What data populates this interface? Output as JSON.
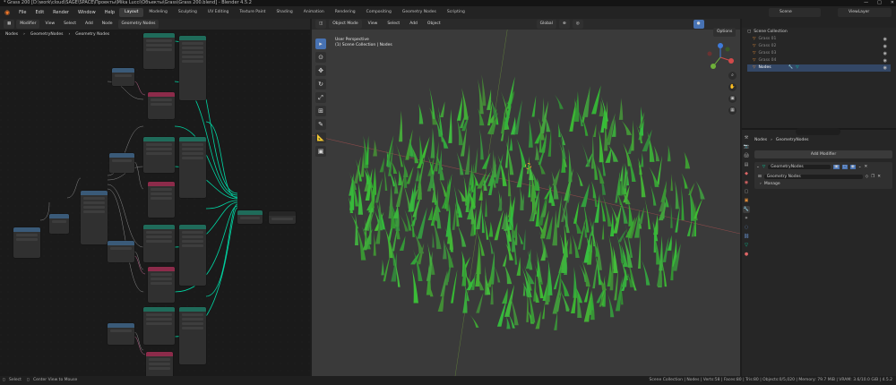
{
  "window": {
    "title": "* Grass 200 [D:\\work\\cloud\\SAGE\\SPACE\\Проекты\\Mika Lucci\\Объекты\\Grass\\Grass 200.blend] - Blender 4.5.2",
    "controls": [
      "—",
      "□",
      "✕"
    ]
  },
  "menus": [
    "File",
    "Edit",
    "Render",
    "Window",
    "Help"
  ],
  "workspaces": [
    {
      "label": "Layout",
      "active": true
    },
    {
      "label": "Modeling"
    },
    {
      "label": "Sculpting"
    },
    {
      "label": "UV Editing"
    },
    {
      "label": "Texture Paint"
    },
    {
      "label": "Shading"
    },
    {
      "label": "Animation"
    },
    {
      "label": "Rendering"
    },
    {
      "label": "Compositing"
    },
    {
      "label": "Geometry Nodes"
    },
    {
      "label": "Scripting"
    }
  ],
  "scene": "Scene",
  "view_layer": "ViewLayer",
  "node_editor": {
    "header": {
      "editor": "Modifier",
      "menus": [
        "View",
        "Select",
        "Add",
        "Node"
      ],
      "tree": "Geometry Nodes"
    },
    "breadcrumb": [
      "Nodes",
      "GeometryNodes",
      "Geometry Nodes"
    ]
  },
  "viewport": {
    "header": {
      "mode": "Object Mode",
      "menus": [
        "View",
        "Select",
        "Add",
        "Object"
      ],
      "orientation": "Global",
      "options": "Options"
    },
    "info_line1": "User Perspective",
    "info_line2": "(1) Scene Collection | Nodes",
    "tools": [
      "select-box",
      "cursor",
      "move",
      "rotate",
      "scale",
      "transform",
      "annotate",
      "measure",
      "add-cube"
    ]
  },
  "outliner": {
    "root": "Scene Collection",
    "items": [
      {
        "label": "Grass 01"
      },
      {
        "label": "Grass 02"
      },
      {
        "label": "Grass 03"
      },
      {
        "label": "Grass 04"
      },
      {
        "label": "Nodes"
      }
    ]
  },
  "properties": {
    "search_placeholder": "",
    "breadcrumb": [
      "Nodes",
      "GeometryNodes"
    ],
    "add_modifier": "Add Modifier",
    "modifier_name": "GeometryNodes",
    "node_group": "Geometry Nodes",
    "manage": "Manage"
  },
  "status": {
    "left_select": "Select",
    "left_center": "Center View to Mouse",
    "right": "Scene Collection | Nodes | Verts:58 | Faces:80 | Tris:80 | Objects:0/5,020 | Memory: 79.7 MiB | VRAM: 3.6/10.0 GiB | 4.5.2"
  },
  "colors": {
    "accent": "#4772b3",
    "node_geometry_green": "#00d6a3",
    "grass_green": "#3f9a3a"
  }
}
